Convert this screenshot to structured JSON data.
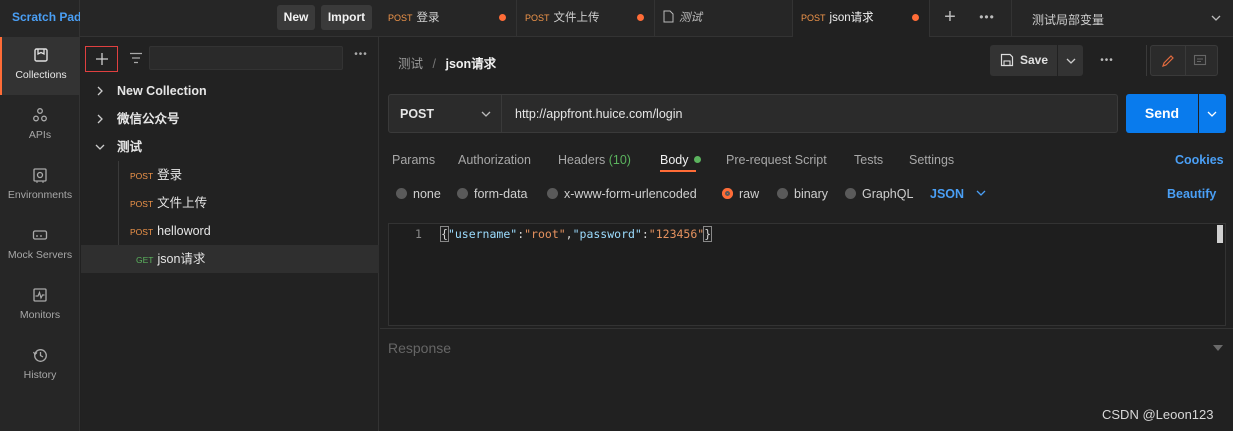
{
  "app": {
    "title": "Scratch Pad"
  },
  "toolbar": {
    "new_label": "New",
    "import_label": "Import"
  },
  "nav": [
    {
      "label": "Collections",
      "icon": "collections-icon"
    },
    {
      "label": "APIs",
      "icon": "apis-icon"
    },
    {
      "label": "Environments",
      "icon": "environments-icon"
    },
    {
      "label": "Mock Servers",
      "icon": "mock-servers-icon"
    },
    {
      "label": "Monitors",
      "icon": "monitors-icon"
    },
    {
      "label": "History",
      "icon": "history-icon"
    }
  ],
  "tabs": [
    {
      "method": "POST",
      "name": "登录",
      "unsaved": true
    },
    {
      "method": "POST",
      "name": "文件上传",
      "unsaved": true
    },
    {
      "method": "",
      "name": "测试",
      "unsaved": false
    },
    {
      "method": "POST",
      "name": "json请求",
      "unsaved": true
    }
  ],
  "environment": {
    "selected": "测试局部变量"
  },
  "tree": {
    "collections": [
      {
        "name": "New Collection"
      },
      {
        "name": "微信公众号"
      },
      {
        "name": "测试"
      }
    ],
    "requests": [
      {
        "method": "POST",
        "name": "登录"
      },
      {
        "method": "POST",
        "name": "文件上传"
      },
      {
        "method": "POST",
        "name": "helloword"
      },
      {
        "method": "GET",
        "name": "json请求"
      }
    ]
  },
  "request": {
    "breadcrumb_parent": "测试",
    "breadcrumb_sep": "/",
    "breadcrumb_current": "json请求",
    "save_label": "Save",
    "method": "POST",
    "url": "http://appfront.huice.com/login",
    "send_label": "Send",
    "subtabs": {
      "params": "Params",
      "authorization": "Authorization",
      "headers": "Headers",
      "headers_count": "(10)",
      "body": "Body",
      "prerequest": "Pre-request Script",
      "tests": "Tests",
      "settings": "Settings",
      "cookies": "Cookies"
    },
    "body_types": {
      "none": "none",
      "form_data": "form-data",
      "urlencoded": "x-www-form-urlencoded",
      "raw": "raw",
      "binary": "binary",
      "graphql": "GraphQL"
    },
    "raw_format": "JSON",
    "beautify": "Beautify",
    "editor": {
      "line_number": "1",
      "brace_open": "{",
      "k1": "\"username\"",
      "colon1": ":",
      "v1": "\"root\"",
      "comma": ",",
      "k2": "\"password\"",
      "colon2": ":",
      "v2": "\"123456\"",
      "brace_close": "}"
    }
  },
  "response": {
    "label": "Response"
  },
  "watermark": "CSDN @Leoon123",
  "colors": {
    "accent": "#ff6c37",
    "primary": "#097bed",
    "link": "#4a9ff5",
    "post": "#f0954a",
    "get": "#5bb35e",
    "headers_count": "#5bb35e"
  }
}
